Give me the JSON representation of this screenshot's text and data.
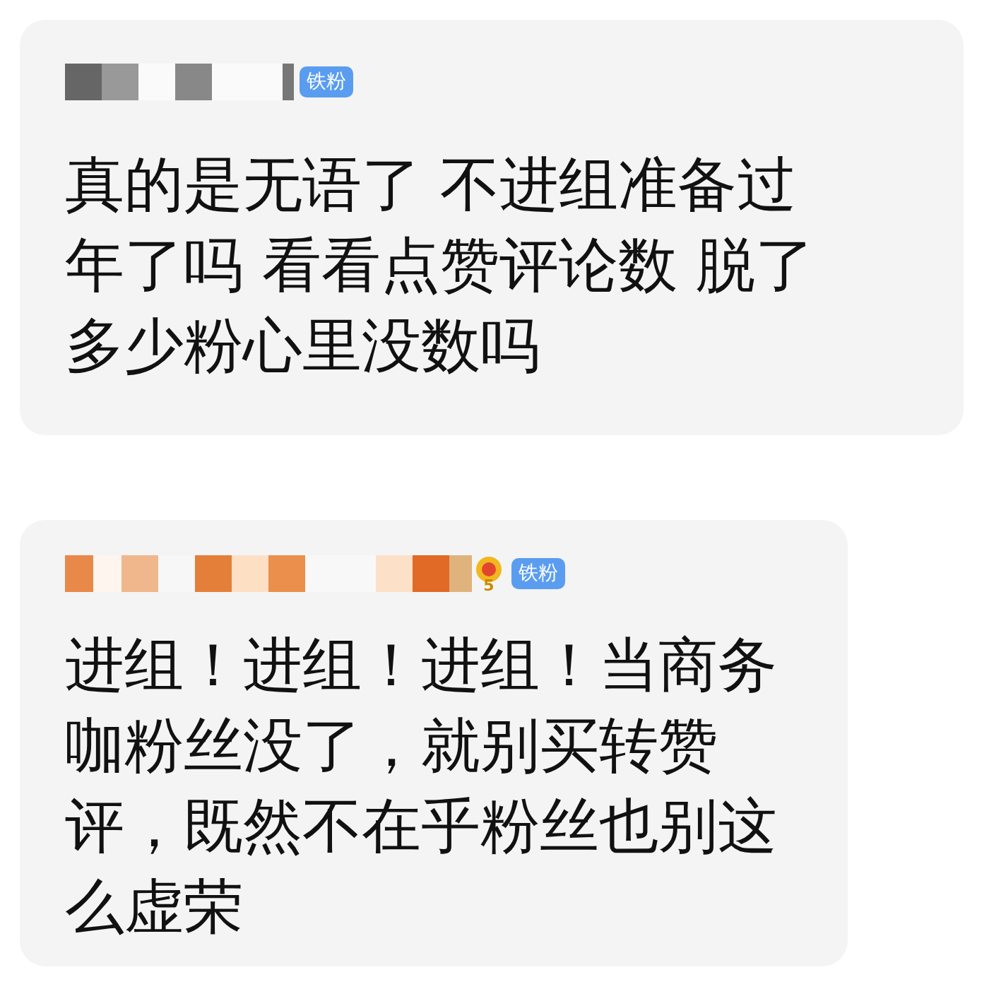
{
  "comments": [
    {
      "badge": "铁粉",
      "kind": "gray",
      "lines": [
        "真的是无语了 不进组准备过",
        "年了吗 看看点赞评论数 脱了",
        "多少粉心里没数吗"
      ]
    },
    {
      "badge": "铁粉",
      "medal": "5",
      "kind": "orange",
      "lines": [
        "进组！进组！进组！当商务",
        "咖粉丝没了，就别买转赞",
        "评，既然不在乎粉丝也别这",
        "么虚荣"
      ]
    }
  ]
}
